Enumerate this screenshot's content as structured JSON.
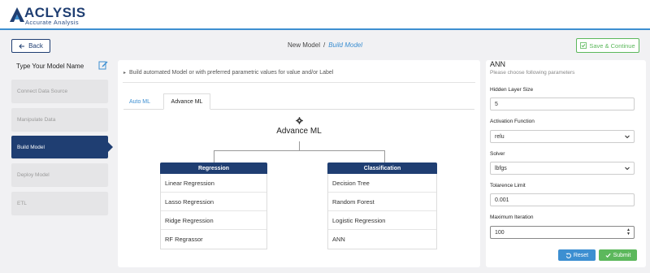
{
  "brand": {
    "name": "ACLYSIS",
    "tagline": "Accurate Analysis",
    "primary_color": "#1f3e72",
    "accent_color": "#3d8fd1",
    "success_color": "#5cb85c"
  },
  "topbar": {
    "back_label": "Back",
    "breadcrumb": {
      "parent": "New Model",
      "separator": "/",
      "current": "Build Model"
    },
    "save_label": "Save & Continue"
  },
  "sidebar": {
    "model_name_placeholder": "Type Your Model Name",
    "steps": [
      {
        "label": "Connect Data Source"
      },
      {
        "label": "Manipulate Data"
      },
      {
        "label": "Build Model",
        "active": true
      },
      {
        "label": "Deploy Model"
      },
      {
        "label": "ETL"
      }
    ]
  },
  "center": {
    "description": "Build automated Model or with preferred parametric values for value and/or Label",
    "tabs": [
      {
        "label": "Auto ML"
      },
      {
        "label": "Advance ML",
        "active": true
      }
    ],
    "tree_title": "Advance ML",
    "categories": [
      {
        "title": "Regression",
        "items": [
          "Linear Regression",
          "Lasso Regression",
          "Ridge Regression",
          "RF Regrassor"
        ]
      },
      {
        "title": "Classification",
        "items": [
          "Decision Tree",
          "Random Forest",
          "Logistic Regression",
          "ANN"
        ]
      }
    ]
  },
  "params": {
    "title": "ANN",
    "subtitle": "Please choose following parameters",
    "fields": [
      {
        "label": "Hidden Layer Size",
        "value": "5",
        "type": "text"
      },
      {
        "label": "Activation Function",
        "value": "relu",
        "type": "select"
      },
      {
        "label": "Solver",
        "value": "lbfgs",
        "type": "select"
      },
      {
        "label": "Tolarence Limit",
        "value": "0.001",
        "type": "text"
      },
      {
        "label": "Maximum Iteration",
        "value": "100",
        "type": "number"
      }
    ],
    "reset_label": "Reset",
    "submit_label": "Submit"
  }
}
